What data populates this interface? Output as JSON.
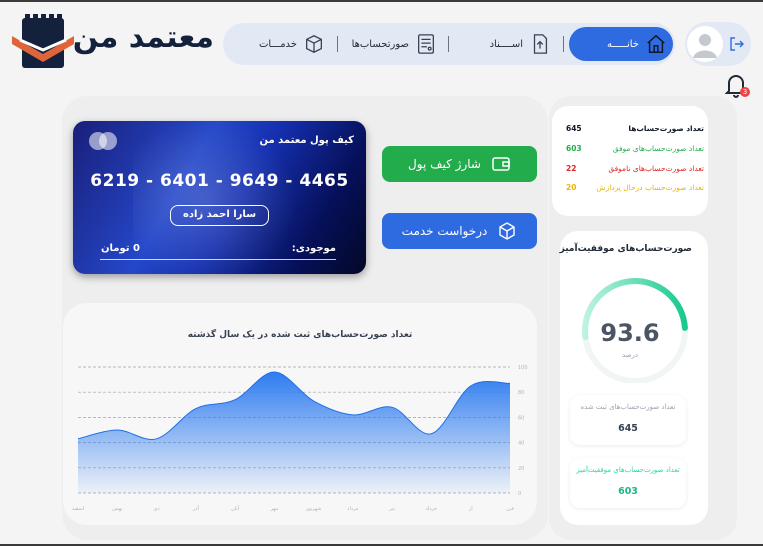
{
  "header": {
    "brand": "معتمد من",
    "nav": {
      "home": "خانـــــه",
      "documents": "اســــناد",
      "invoices": "صورتحساب‌ها",
      "services": "خدمـــات"
    }
  },
  "notifications": {
    "count": "3"
  },
  "wallet": {
    "title": "کیف پول معتمد من",
    "card_number": "6219 - 6401 - 9649 - 4465",
    "holder": "سارا احمد زاده",
    "balance_label": "موجودی:",
    "balance": "0 تومان"
  },
  "actions": {
    "charge": "شارژ کیف پول",
    "service": "درخواست خدمت"
  },
  "stats": {
    "total_label": "تعداد صورت‌حساب‌ها",
    "total_value": "645",
    "success_label": "تعداد صورت‌حساب‌های موفق",
    "success_value": "603",
    "failed_label": "تعداد صورت‌حساب‌های ناموفق",
    "failed_value": "22",
    "pending_label": "تعداد صورت‌حساب درحال پردازش",
    "pending_value": "20"
  },
  "success": {
    "title": "صورت‌حساب‌های موفقیت‌آمیز",
    "percent": "93.6",
    "percent_value": 93.6,
    "unit": "درصد",
    "registered_label": "تعداد صورت‌حساب‌های ثبت شده",
    "registered_value": "645",
    "successful_label": "تعداد صورت‌حساب‌های موفقیت‌آمیز",
    "successful_value": "603"
  },
  "colors": {
    "primary": "#2f6be0",
    "success": "#22ac4c",
    "failed": "#dc2626",
    "pending": "#eab308",
    "gauge": "#2bd6a0",
    "brand": "#14213d",
    "logo_accent": "#e0643a"
  },
  "chart_data": {
    "type": "area",
    "title": "تعداد صورت‌حساب‌های ثبت شده در یک سال گذشته",
    "categories": [
      "اسفند",
      "بهمن",
      "دی",
      "آذر",
      "آبان",
      "مهر",
      "شهریور",
      "مرداد",
      "تیر",
      "خرداد",
      "ار",
      "فرر"
    ],
    "values": [
      43,
      50,
      43,
      67,
      74,
      96,
      73,
      62,
      68,
      47,
      85,
      87
    ],
    "yticks": [
      "100",
      "80",
      "60",
      "40",
      "20",
      "0"
    ],
    "ylim": [
      0,
      100
    ],
    "grid": true
  }
}
